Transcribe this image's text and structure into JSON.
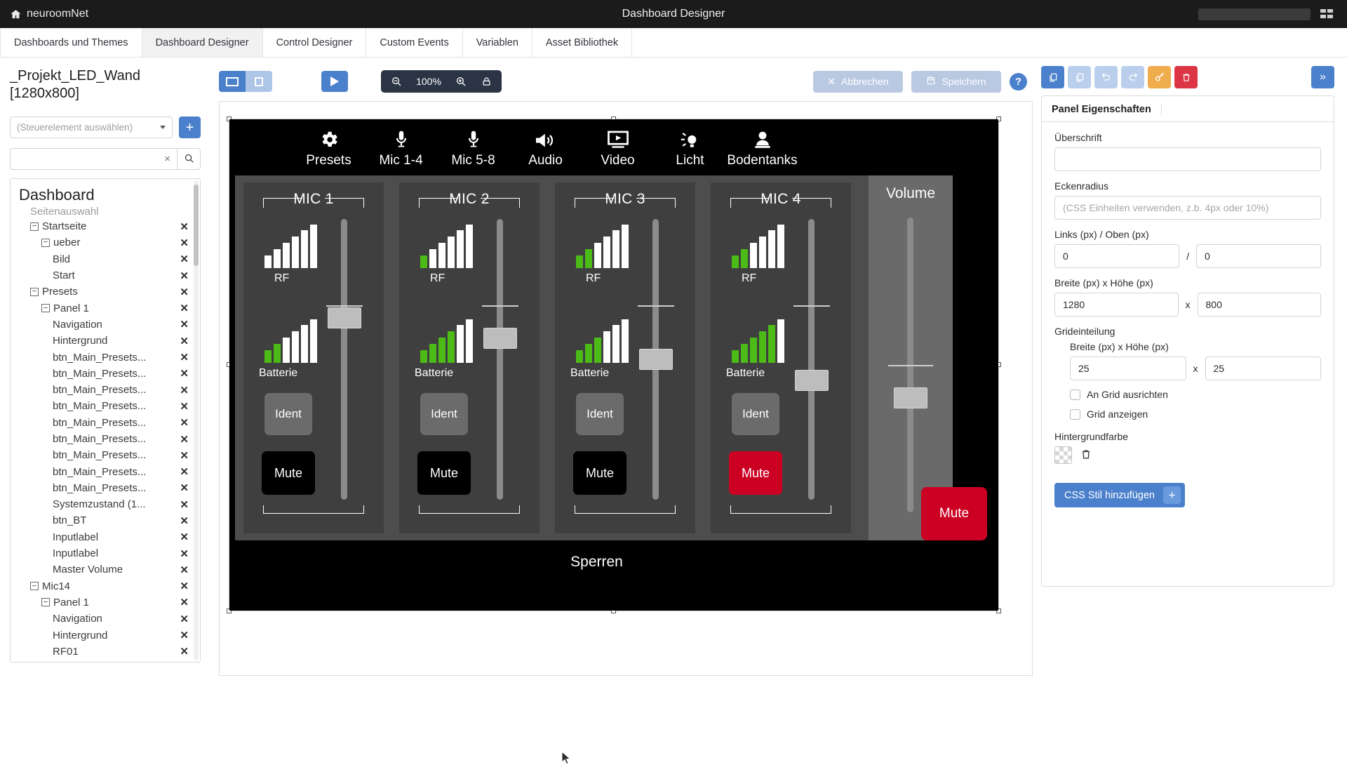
{
  "topbar": {
    "brand": "neuroomNet",
    "title": "Dashboard Designer",
    "home_icon": "home-icon",
    "apps_icon": "grid-apps-icon"
  },
  "tabs": [
    {
      "label": "Dashboards und Themes",
      "active": false
    },
    {
      "label": "Dashboard Designer",
      "active": true
    },
    {
      "label": "Control Designer",
      "active": false
    },
    {
      "label": "Custom Events",
      "active": false
    },
    {
      "label": "Variablen",
      "active": false
    },
    {
      "label": "Asset Bibliothek",
      "active": false
    }
  ],
  "left": {
    "project_name": "_Projekt_LED_Wand",
    "project_size": "[1280x800]",
    "select_placeholder": "(Steuerelement auswählen)",
    "add_label": "+",
    "search_value": "",
    "search_clear": "×",
    "search_icon": "search-icon",
    "tree_title": "Dashboard",
    "tree_subtitle": "Seitenauswahl",
    "tree": [
      {
        "label": "Startseite",
        "indent": 1,
        "expander": "−",
        "close": "✕"
      },
      {
        "label": "ueber",
        "indent": 2,
        "expander": "−",
        "close": "✕"
      },
      {
        "label": "Bild",
        "indent": 3,
        "expander": "",
        "close": "✕"
      },
      {
        "label": "Start",
        "indent": 3,
        "expander": "",
        "close": "✕"
      },
      {
        "label": "Presets",
        "indent": 1,
        "expander": "−",
        "close": "✕"
      },
      {
        "label": "Panel 1",
        "indent": 2,
        "expander": "−",
        "close": "✕"
      },
      {
        "label": "Navigation",
        "indent": 3,
        "expander": "",
        "close": "✕"
      },
      {
        "label": "Hintergrund",
        "indent": 3,
        "expander": "",
        "close": "✕"
      },
      {
        "label": "btn_Main_Presets...",
        "indent": 3,
        "expander": "",
        "close": "✕"
      },
      {
        "label": "btn_Main_Presets...",
        "indent": 3,
        "expander": "",
        "close": "✕"
      },
      {
        "label": "btn_Main_Presets...",
        "indent": 3,
        "expander": "",
        "close": "✕"
      },
      {
        "label": "btn_Main_Presets...",
        "indent": 3,
        "expander": "",
        "close": "✕"
      },
      {
        "label": "btn_Main_Presets...",
        "indent": 3,
        "expander": "",
        "close": "✕"
      },
      {
        "label": "btn_Main_Presets...",
        "indent": 3,
        "expander": "",
        "close": "✕"
      },
      {
        "label": "btn_Main_Presets...",
        "indent": 3,
        "expander": "",
        "close": "✕"
      },
      {
        "label": "btn_Main_Presets...",
        "indent": 3,
        "expander": "",
        "close": "✕"
      },
      {
        "label": "btn_Main_Presets...",
        "indent": 3,
        "expander": "",
        "close": "✕"
      },
      {
        "label": "Systemzustand (1...",
        "indent": 3,
        "expander": "",
        "close": "✕"
      },
      {
        "label": "btn_BT",
        "indent": 3,
        "expander": "",
        "close": "✕"
      },
      {
        "label": "Inputlabel",
        "indent": 3,
        "expander": "",
        "close": "✕"
      },
      {
        "label": "Inputlabel",
        "indent": 3,
        "expander": "",
        "close": "✕"
      },
      {
        "label": "Master Volume",
        "indent": 3,
        "expander": "",
        "close": "✕"
      },
      {
        "label": "Mic14",
        "indent": 1,
        "expander": "−",
        "close": "✕"
      },
      {
        "label": "Panel 1",
        "indent": 2,
        "expander": "−",
        "close": "✕"
      },
      {
        "label": "Navigation",
        "indent": 3,
        "expander": "",
        "close": "✕"
      },
      {
        "label": "Hintergrund",
        "indent": 3,
        "expander": "",
        "close": "✕"
      },
      {
        "label": "RF01",
        "indent": 3,
        "expander": "",
        "close": "✕"
      }
    ]
  },
  "canvas_toolbar": {
    "view_single_icon": "layout-single-icon",
    "view_split_icon": "layout-split-icon",
    "preview_icon": "play-icon",
    "zoom_out_icon": "zoom-out-icon",
    "zoom_level": "100%",
    "zoom_in_icon": "zoom-in-icon",
    "lock_icon": "lock-icon",
    "cancel_label": "Abbrechen",
    "cancel_icon": "close-icon",
    "save_label": "Speichern",
    "save_icon": "save-disk-icon",
    "help_label": "?"
  },
  "dashboard": {
    "nav": [
      {
        "label": "Presets",
        "icon": "gear-icon"
      },
      {
        "label": "Mic 1-4",
        "icon": "microphone-icon"
      },
      {
        "label": "Mic 5-8",
        "icon": "microphone-icon"
      },
      {
        "label": "Audio",
        "icon": "speaker-volume-icon"
      },
      {
        "label": "Video",
        "icon": "video-monitor-icon"
      },
      {
        "label": "Licht",
        "icon": "light-bulb-icon"
      },
      {
        "label": "Bodentanks",
        "icon": "floor-tank-icon"
      }
    ],
    "channels": [
      {
        "title": "MIC 1",
        "rf_label": "RF",
        "rf_bars": [
          1,
          2,
          3,
          4,
          5,
          6
        ],
        "rf_green": 0,
        "bat_label": "Batterie",
        "bat_bars": [
          1,
          2,
          3,
          4,
          5,
          6
        ],
        "bat_green": 2,
        "ident_label": "Ident",
        "mute_label": "Mute",
        "mute_on": false,
        "fader": 34
      },
      {
        "title": "MIC 2",
        "rf_label": "RF",
        "rf_bars": [
          1,
          2,
          3,
          4,
          5,
          6
        ],
        "rf_green": 1,
        "bat_label": "Batterie",
        "bat_bars": [
          1,
          2,
          3,
          4,
          5,
          6
        ],
        "bat_green": 4,
        "ident_label": "Ident",
        "mute_label": "Mute",
        "mute_on": false,
        "fader": 42
      },
      {
        "title": "MIC 3",
        "rf_label": "RF",
        "rf_bars": [
          1,
          2,
          3,
          4,
          5,
          6
        ],
        "rf_green": 2,
        "bat_label": "Batterie",
        "bat_bars": [
          1,
          2,
          3,
          4,
          5,
          6
        ],
        "bat_green": 3,
        "ident_label": "Ident",
        "mute_label": "Mute",
        "mute_on": false,
        "fader": 50
      },
      {
        "title": "MIC 4",
        "rf_label": "RF",
        "rf_bars": [
          1,
          2,
          3,
          4,
          5,
          6
        ],
        "rf_green": 2,
        "bat_label": "Batterie",
        "bat_bars": [
          1,
          2,
          3,
          4,
          5,
          6
        ],
        "bat_green": 5,
        "ident_label": "Ident",
        "mute_label": "Mute",
        "mute_on": true,
        "fader": 58
      }
    ],
    "volume": {
      "label": "Volume",
      "fader": 62
    },
    "lock_button": "Sperren",
    "master_mute": "Mute"
  },
  "right": {
    "toolbar": [
      {
        "icon": "copy-icon",
        "style": "blue"
      },
      {
        "icon": "paste-icon",
        "style": "blue-l"
      },
      {
        "icon": "undo-icon",
        "style": "blue-l"
      },
      {
        "icon": "redo-icon",
        "style": "blue-l"
      },
      {
        "icon": "key-icon",
        "style": "amber"
      },
      {
        "icon": "trash-icon",
        "style": "red"
      }
    ],
    "expand_icon": "chevrons-right-icon",
    "panel_tab": "Panel Eigenschaften",
    "fields": {
      "ueberschrift_label": "Überschrift",
      "ueberschrift_value": "",
      "eckenradius_label": "Eckenradius",
      "eckenradius_placeholder": "(CSS Einheiten verwenden, z.b. 4px oder 10%)",
      "pos_label": "Links (px) / Oben (px)",
      "pos_left": "0",
      "pos_sep": "/",
      "pos_top": "0",
      "size_label": "Breite (px) x Höhe (px)",
      "size_w": "1280",
      "size_sep": "x",
      "size_h": "800",
      "grid_label": "Grideinteilung",
      "grid_sub_label": "Breite (px) x Höhe (px)",
      "grid_w": "25",
      "grid_sep": "x",
      "grid_h": "25",
      "snap_label": "An Grid ausrichten",
      "showgrid_label": "Grid anzeigen",
      "bg_label": "Hintergrundfarbe",
      "bg_swatch_icon": "transparent-swatch",
      "bg_delete_icon": "trash-icon",
      "css_button": "CSS Stil hinzufügen",
      "css_button_plus": "+"
    }
  },
  "colors": {
    "accent": "#4a80cc",
    "danger": "#cc0022",
    "green": "#4cbb17",
    "dark": "#2b3445"
  }
}
